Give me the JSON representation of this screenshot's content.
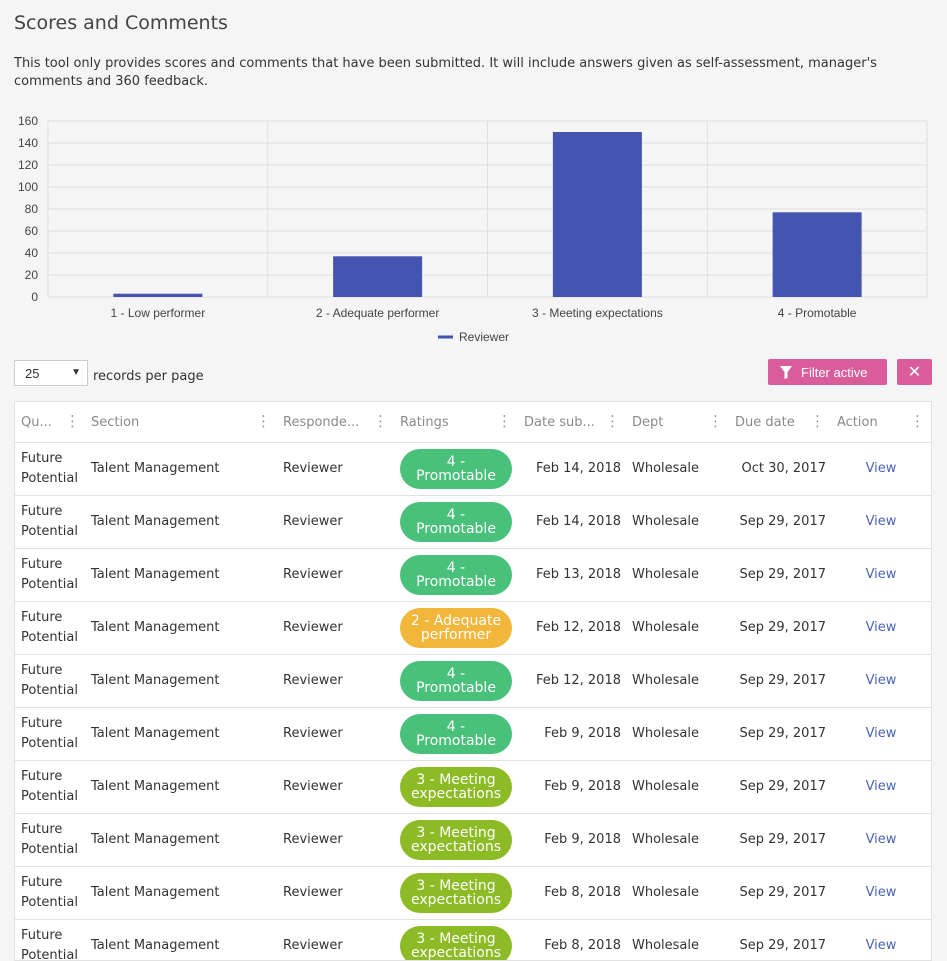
{
  "page": {
    "title": "Scores and Comments",
    "intro": "This tool only provides scores and comments that have been submitted. It will include answers given as self-assessment, manager's comments and 360 feedback."
  },
  "chart_data": {
    "type": "bar",
    "categories": [
      "1 - Low performer",
      "2 - Adequate performer",
      "3 - Meeting expectations",
      "4 - Promotable"
    ],
    "series": [
      {
        "name": "Reviewer",
        "values": [
          3,
          37,
          150,
          77
        ]
      }
    ],
    "ylim": [
      0,
      160
    ],
    "yticks": [
      0,
      20,
      40,
      60,
      80,
      100,
      120,
      140,
      160
    ],
    "grid": true,
    "legend": "bottom",
    "color": "#4554b0"
  },
  "controls": {
    "page_size": "25",
    "records_label": "records per page",
    "filter_label": "Filter active"
  },
  "table": {
    "headers": {
      "question": "Qu...",
      "section": "Section",
      "respondent": "Responde...",
      "ratings": "Ratings",
      "date_submitted": "Date sub...",
      "dept": "Dept",
      "due_date": "Due date",
      "action": "Action"
    },
    "rows": [
      {
        "question": "Future Potential",
        "section": "Talent Management",
        "respondent": "Reviewer",
        "rating": "4 - Promotable",
        "date_submitted": "Feb 14, 2018",
        "dept": "Wholesale",
        "due_date": "Oct 30, 2017",
        "action": "View"
      },
      {
        "question": "Future Potential",
        "section": "Talent Management",
        "respondent": "Reviewer",
        "rating": "4 - Promotable",
        "date_submitted": "Feb 14, 2018",
        "dept": "Wholesale",
        "due_date": "Sep 29, 2017",
        "action": "View"
      },
      {
        "question": "Future Potential",
        "section": "Talent Management",
        "respondent": "Reviewer",
        "rating": "4 - Promotable",
        "date_submitted": "Feb 13, 2018",
        "dept": "Wholesale",
        "due_date": "Sep 29, 2017",
        "action": "View"
      },
      {
        "question": "Future Potential",
        "section": "Talent Management",
        "respondent": "Reviewer",
        "rating": "2 - Adequate performer",
        "date_submitted": "Feb 12, 2018",
        "dept": "Wholesale",
        "due_date": "Sep 29, 2017",
        "action": "View"
      },
      {
        "question": "Future Potential",
        "section": "Talent Management",
        "respondent": "Reviewer",
        "rating": "4 - Promotable",
        "date_submitted": "Feb 12, 2018",
        "dept": "Wholesale",
        "due_date": "Sep 29, 2017",
        "action": "View"
      },
      {
        "question": "Future Potential",
        "section": "Talent Management",
        "respondent": "Reviewer",
        "rating": "4 - Promotable",
        "date_submitted": "Feb 9, 2018",
        "dept": "Wholesale",
        "due_date": "Sep 29, 2017",
        "action": "View"
      },
      {
        "question": "Future Potential",
        "section": "Talent Management",
        "respondent": "Reviewer",
        "rating": "3 - Meeting expectations",
        "date_submitted": "Feb 9, 2018",
        "dept": "Wholesale",
        "due_date": "Sep 29, 2017",
        "action": "View"
      },
      {
        "question": "Future Potential",
        "section": "Talent Management",
        "respondent": "Reviewer",
        "rating": "3 - Meeting expectations",
        "date_submitted": "Feb 9, 2018",
        "dept": "Wholesale",
        "due_date": "Sep 29, 2017",
        "action": "View"
      },
      {
        "question": "Future Potential",
        "section": "Talent Management",
        "respondent": "Reviewer",
        "rating": "3 - Meeting expectations",
        "date_submitted": "Feb 8, 2018",
        "dept": "Wholesale",
        "due_date": "Sep 29, 2017",
        "action": "View"
      },
      {
        "question": "Future Potential",
        "section": "Talent Management",
        "respondent": "Reviewer",
        "rating": "3 - Meeting expectations",
        "date_submitted": "Feb 8, 2018",
        "dept": "Wholesale",
        "due_date": "Sep 29, 2017",
        "action": "View"
      }
    ]
  },
  "rating_colors": {
    "1 - Low performer": "#e05a5a",
    "2 - Adequate performer": "#f2b63a",
    "3 - Meeting expectations": "#8cbb26",
    "4 - Promotable": "#49c17a"
  },
  "icons": {
    "filter": "filter-icon",
    "clear": "close-icon",
    "column_menu": "column-menu-icon",
    "dropdown": "chevron-down-icon"
  }
}
